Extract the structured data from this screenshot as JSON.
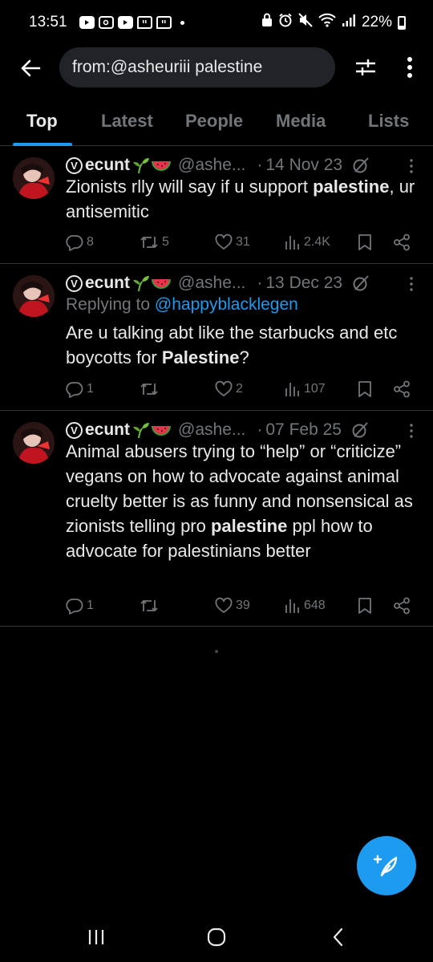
{
  "status_bar": {
    "time": "13:51",
    "battery": "22%",
    "app_icons": [
      "youtube-icon",
      "instagram-icon",
      "youtube-icon",
      "twitch-icon",
      "twitch-icon"
    ]
  },
  "search": {
    "query": "from:@asheuriii palestine"
  },
  "tabs": [
    {
      "label": "Top",
      "active": true
    },
    {
      "label": "Latest",
      "active": false
    },
    {
      "label": "People",
      "active": false
    },
    {
      "label": "Media",
      "active": false
    },
    {
      "label": "Lists",
      "active": false
    }
  ],
  "tweets": [
    {
      "name_prefix": "V",
      "name": "ecunt",
      "emojis": [
        "seedling",
        "watermelon"
      ],
      "handle": "@ashe...",
      "dot": "·",
      "date": "14 Nov 23",
      "reply_to_label": "",
      "reply_to": "",
      "text_parts": [
        "Zionists rlly will say if u support ",
        "palestine",
        ", ur antisemitic"
      ],
      "replies": "8",
      "reposts": "5",
      "likes": "31",
      "views": "2.4K"
    },
    {
      "name_prefix": "V",
      "name": "ecunt",
      "emojis": [
        "seedling",
        "watermelon"
      ],
      "handle": "@ashe...",
      "dot": "·",
      "date": "13 Dec 23",
      "reply_to_label": "Replying to ",
      "reply_to": "@happyblacklegen",
      "text_parts": [
        "Are u talking abt like the starbucks and etc boycotts for ",
        "Palestine",
        "?"
      ],
      "replies": "1",
      "reposts": "",
      "likes": "2",
      "views": "107"
    },
    {
      "name_prefix": "V",
      "name": "ecunt",
      "emojis": [
        "seedling",
        "watermelon"
      ],
      "handle": "@ashe...",
      "dot": "·",
      "date": "07 Feb 25",
      "reply_to_label": "",
      "reply_to": "",
      "text_parts": [
        "Animal abusers trying to “help” or “criticize” vegans on how to advocate against animal cruelty better is as funny and nonsensical as zionists telling pro ",
        "palestine",
        " ppl how to advocate for palestinians better"
      ],
      "replies": "1",
      "reposts": "",
      "likes": "39",
      "views": "648"
    }
  ],
  "colors": {
    "background": "#000000",
    "accent": "#1d9bf0",
    "text": "#e7e9ea",
    "muted": "#71767b",
    "divider": "#2f3336",
    "search_bg": "#202327"
  }
}
